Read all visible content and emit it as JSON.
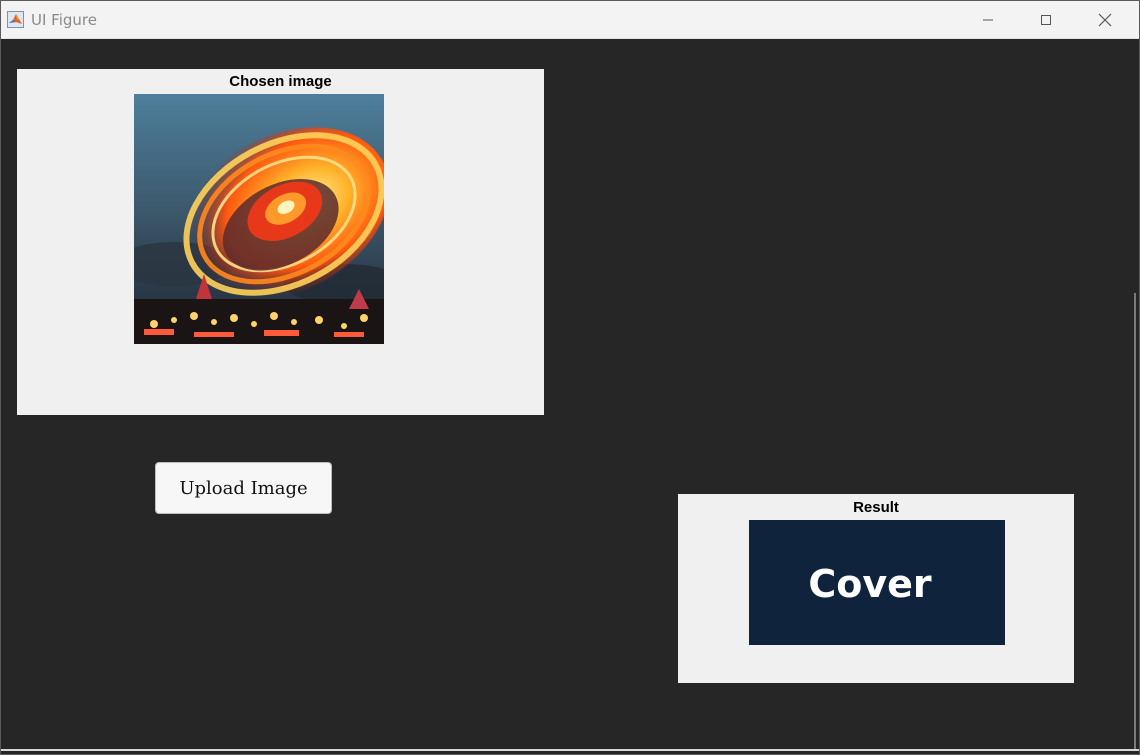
{
  "window": {
    "title": "UI Figure",
    "icon": "matlab-icon",
    "controls": {
      "minimize": "minimize-icon",
      "maximize": "maximize-icon",
      "close": "close-icon"
    }
  },
  "chosen_axes": {
    "title": "Chosen image",
    "image": "ferris-wheel-long-exposure-photo"
  },
  "upload": {
    "label": "Upload Image"
  },
  "result_axes": {
    "title": "Result",
    "image_text": "Cover",
    "image_bg": "#0f233d"
  },
  "colors": {
    "background": "#262626",
    "panel": "#f0f0f0",
    "titlebar": "#f3f3f3"
  }
}
